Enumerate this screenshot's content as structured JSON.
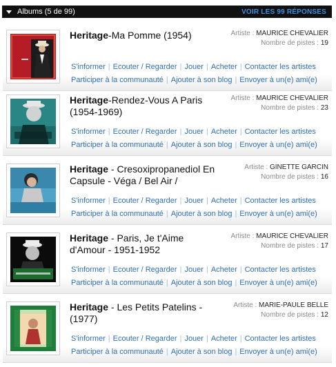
{
  "header": {
    "title": "Albums (5 de 99)",
    "all_results": "VOIR LES 99 RÉPONSES"
  },
  "labels": {
    "artist": "Artiste : ",
    "tracks": "Nombre de pistes : "
  },
  "actions": [
    "S'informer",
    "Ecouter / Regarder",
    "Jouer",
    "Acheter",
    "Contacter les artistes"
  ],
  "actions2": [
    "Participer à la communauté",
    "Ajouter à son blog",
    "Envoyer à un(e) ami(e)"
  ],
  "albums": [
    {
      "series": "Heritage",
      "rest": "-Ma Pomme (1954)",
      "artist": "MAURICE CHEVALIER",
      "tracks": "19"
    },
    {
      "series": "Heritage",
      "rest": "-Rendez-Vous A Paris (1954-1969)",
      "artist": "MAURICE CHEVALIER",
      "tracks": "23"
    },
    {
      "series": "Heritage",
      "rest": " - Cresoxipropanediol En Capsule - Véga / Bel Air /",
      "artist": "GINETTE GARCIN",
      "tracks": "16"
    },
    {
      "series": "Heritage",
      "rest": " - Paris, Je t'Aime d'Amour - 1951-1952",
      "artist": "MAURICE CHEVALIER",
      "tracks": "17"
    },
    {
      "series": "Heritage",
      "rest": " - Les Petits Patelins - (1977)",
      "artist": "MARIE-PAULE BELLE",
      "tracks": "12"
    }
  ],
  "cover_texts": [
    "Maurice Chevalier",
    "Maurice Chevalier",
    "Ginette Garcin",
    "Maurice Chevalier",
    ""
  ]
}
